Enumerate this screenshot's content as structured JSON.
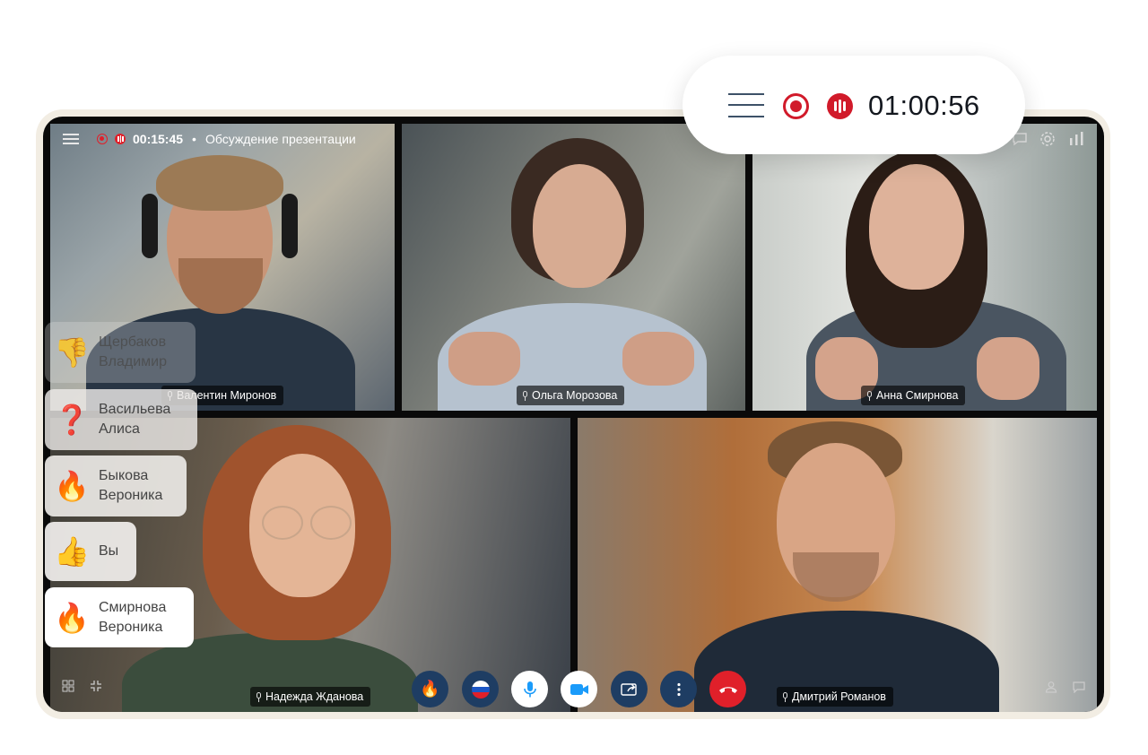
{
  "callout": {
    "timer": "01:00:56"
  },
  "topbar": {
    "timer": "00:15:45",
    "separator": "•",
    "title": "Обсуждение презентации"
  },
  "participants": [
    {
      "name": "Валентин Миронов"
    },
    {
      "name": "Ольга Морозова"
    },
    {
      "name": "Анна Смирнова"
    },
    {
      "name": "Надежда Жданова"
    },
    {
      "name": "Дмитрий Романов"
    }
  ],
  "reactions": [
    {
      "emoji": "👎",
      "name": "Щербаков\nВладимир"
    },
    {
      "emoji": "❓",
      "name": "Васильева\nАлиса"
    },
    {
      "emoji": "🔥",
      "name": "Быкова\nВероника"
    },
    {
      "emoji": "👍",
      "name": "Вы"
    },
    {
      "emoji": "🔥",
      "name": "Смирнова\nВероника"
    }
  ],
  "controls": {
    "reaction_emoji": "🔥"
  },
  "colors": {
    "record_red": "#d11a2a",
    "active_blue": "#1a9bfa",
    "control_dark": "#1e3d63",
    "end_call_red": "#e0202a"
  },
  "icons": [
    "menu-icon",
    "record-icon",
    "live-icon",
    "chat-icon",
    "gear-icon",
    "stats-icon",
    "grid-icon",
    "collapse-icon",
    "flag-icon",
    "mic-icon",
    "camera-icon",
    "share-icon",
    "more-icon",
    "hangup-icon",
    "participants-icon",
    "message-icon"
  ]
}
